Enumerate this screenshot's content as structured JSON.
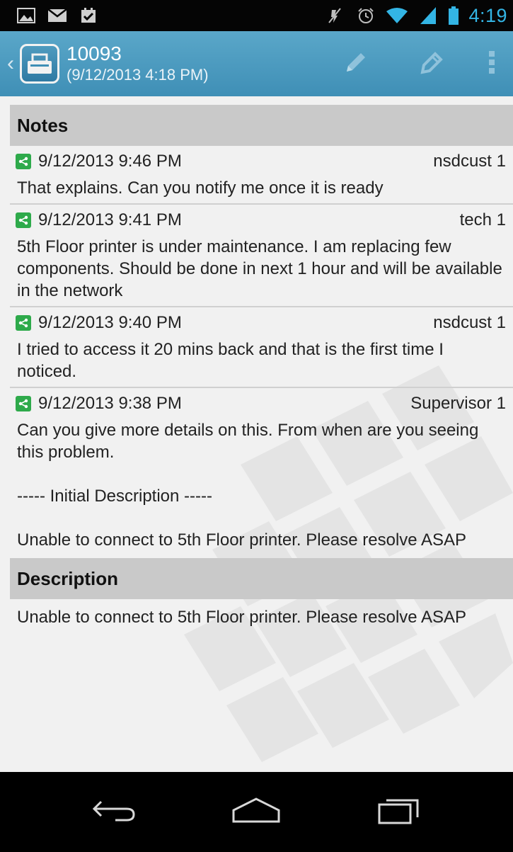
{
  "status_bar": {
    "time": "4:19",
    "icons_left": [
      "picture-icon",
      "mail-icon",
      "checkbox-icon"
    ],
    "icons_right": [
      "mute-icon",
      "alarm-icon",
      "wifi-icon",
      "signal-icon",
      "battery-icon"
    ]
  },
  "action_bar": {
    "title": "10093",
    "subtitle": "(9/12/2013 4:18 PM)",
    "actions": [
      "pencil-icon",
      "edit-tag-icon",
      "overflow-menu-icon"
    ],
    "accent_color": "#4a9bbf"
  },
  "notes": {
    "header": "Notes",
    "items": [
      {
        "timestamp": "9/12/2013 9:46 PM",
        "user": "nsdcust 1",
        "text": "That explains. Can you notify me once it is ready"
      },
      {
        "timestamp": "9/12/2013 9:41 PM",
        "user": "tech 1",
        "text": "5th Floor printer is under maintenance. I am replacing few components. Should be done in next 1 hour and will be available in the network"
      },
      {
        "timestamp": "9/12/2013 9:40 PM",
        "user": "nsdcust 1",
        "text": "I tried to access it 20 mins back and that is the first time I noticed."
      },
      {
        "timestamp": "9/12/2013 9:38 PM",
        "user": "Supervisor 1",
        "text": "Can you give more details on this. From when are you seeing this problem.\n\n----- Initial Description -----\n\nUnable to connect to 5th Floor printer. Please resolve ASAP"
      }
    ]
  },
  "description": {
    "header": "Description",
    "text": "Unable to connect to 5th Floor printer. Please resolve ASAP"
  },
  "nav_bar": {
    "buttons": [
      "back-icon",
      "home-icon",
      "recent-apps-icon"
    ]
  }
}
